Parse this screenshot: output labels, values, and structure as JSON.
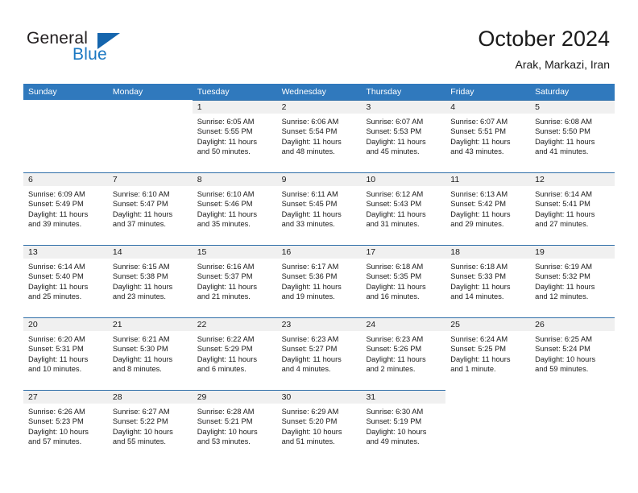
{
  "logo": {
    "word_one": "General",
    "word_two": "Blue",
    "triangle_color": "#1565ad"
  },
  "header": {
    "title": "October 2024",
    "subtitle": "Arak, Markazi, Iran"
  },
  "theme": {
    "header_blue": "#3079bd",
    "daynum_band": "#f0f0f0",
    "rule_blue": "#2e6ea8",
    "text": "#1a1a1a"
  },
  "calendar": {
    "weekdays": [
      "Sunday",
      "Monday",
      "Tuesday",
      "Wednesday",
      "Thursday",
      "Friday",
      "Saturday"
    ],
    "weeks": [
      [
        {
          "day": "",
          "sunrise": "",
          "sunset": "",
          "daylight1": "",
          "daylight2": "",
          "empty": true
        },
        {
          "day": "",
          "sunrise": "",
          "sunset": "",
          "daylight1": "",
          "daylight2": "",
          "empty": true
        },
        {
          "day": "1",
          "sunrise": "Sunrise: 6:05 AM",
          "sunset": "Sunset: 5:55 PM",
          "daylight1": "Daylight: 11 hours",
          "daylight2": "and 50 minutes."
        },
        {
          "day": "2",
          "sunrise": "Sunrise: 6:06 AM",
          "sunset": "Sunset: 5:54 PM",
          "daylight1": "Daylight: 11 hours",
          "daylight2": "and 48 minutes."
        },
        {
          "day": "3",
          "sunrise": "Sunrise: 6:07 AM",
          "sunset": "Sunset: 5:53 PM",
          "daylight1": "Daylight: 11 hours",
          "daylight2": "and 45 minutes."
        },
        {
          "day": "4",
          "sunrise": "Sunrise: 6:07 AM",
          "sunset": "Sunset: 5:51 PM",
          "daylight1": "Daylight: 11 hours",
          "daylight2": "and 43 minutes."
        },
        {
          "day": "5",
          "sunrise": "Sunrise: 6:08 AM",
          "sunset": "Sunset: 5:50 PM",
          "daylight1": "Daylight: 11 hours",
          "daylight2": "and 41 minutes."
        }
      ],
      [
        {
          "day": "6",
          "sunrise": "Sunrise: 6:09 AM",
          "sunset": "Sunset: 5:49 PM",
          "daylight1": "Daylight: 11 hours",
          "daylight2": "and 39 minutes."
        },
        {
          "day": "7",
          "sunrise": "Sunrise: 6:10 AM",
          "sunset": "Sunset: 5:47 PM",
          "daylight1": "Daylight: 11 hours",
          "daylight2": "and 37 minutes."
        },
        {
          "day": "8",
          "sunrise": "Sunrise: 6:10 AM",
          "sunset": "Sunset: 5:46 PM",
          "daylight1": "Daylight: 11 hours",
          "daylight2": "and 35 minutes."
        },
        {
          "day": "9",
          "sunrise": "Sunrise: 6:11 AM",
          "sunset": "Sunset: 5:45 PM",
          "daylight1": "Daylight: 11 hours",
          "daylight2": "and 33 minutes."
        },
        {
          "day": "10",
          "sunrise": "Sunrise: 6:12 AM",
          "sunset": "Sunset: 5:43 PM",
          "daylight1": "Daylight: 11 hours",
          "daylight2": "and 31 minutes."
        },
        {
          "day": "11",
          "sunrise": "Sunrise: 6:13 AM",
          "sunset": "Sunset: 5:42 PM",
          "daylight1": "Daylight: 11 hours",
          "daylight2": "and 29 minutes."
        },
        {
          "day": "12",
          "sunrise": "Sunrise: 6:14 AM",
          "sunset": "Sunset: 5:41 PM",
          "daylight1": "Daylight: 11 hours",
          "daylight2": "and 27 minutes."
        }
      ],
      [
        {
          "day": "13",
          "sunrise": "Sunrise: 6:14 AM",
          "sunset": "Sunset: 5:40 PM",
          "daylight1": "Daylight: 11 hours",
          "daylight2": "and 25 minutes."
        },
        {
          "day": "14",
          "sunrise": "Sunrise: 6:15 AM",
          "sunset": "Sunset: 5:38 PM",
          "daylight1": "Daylight: 11 hours",
          "daylight2": "and 23 minutes."
        },
        {
          "day": "15",
          "sunrise": "Sunrise: 6:16 AM",
          "sunset": "Sunset: 5:37 PM",
          "daylight1": "Daylight: 11 hours",
          "daylight2": "and 21 minutes."
        },
        {
          "day": "16",
          "sunrise": "Sunrise: 6:17 AM",
          "sunset": "Sunset: 5:36 PM",
          "daylight1": "Daylight: 11 hours",
          "daylight2": "and 19 minutes."
        },
        {
          "day": "17",
          "sunrise": "Sunrise: 6:18 AM",
          "sunset": "Sunset: 5:35 PM",
          "daylight1": "Daylight: 11 hours",
          "daylight2": "and 16 minutes."
        },
        {
          "day": "18",
          "sunrise": "Sunrise: 6:18 AM",
          "sunset": "Sunset: 5:33 PM",
          "daylight1": "Daylight: 11 hours",
          "daylight2": "and 14 minutes."
        },
        {
          "day": "19",
          "sunrise": "Sunrise: 6:19 AM",
          "sunset": "Sunset: 5:32 PM",
          "daylight1": "Daylight: 11 hours",
          "daylight2": "and 12 minutes."
        }
      ],
      [
        {
          "day": "20",
          "sunrise": "Sunrise: 6:20 AM",
          "sunset": "Sunset: 5:31 PM",
          "daylight1": "Daylight: 11 hours",
          "daylight2": "and 10 minutes."
        },
        {
          "day": "21",
          "sunrise": "Sunrise: 6:21 AM",
          "sunset": "Sunset: 5:30 PM",
          "daylight1": "Daylight: 11 hours",
          "daylight2": "and 8 minutes."
        },
        {
          "day": "22",
          "sunrise": "Sunrise: 6:22 AM",
          "sunset": "Sunset: 5:29 PM",
          "daylight1": "Daylight: 11 hours",
          "daylight2": "and 6 minutes."
        },
        {
          "day": "23",
          "sunrise": "Sunrise: 6:23 AM",
          "sunset": "Sunset: 5:27 PM",
          "daylight1": "Daylight: 11 hours",
          "daylight2": "and 4 minutes."
        },
        {
          "day": "24",
          "sunrise": "Sunrise: 6:23 AM",
          "sunset": "Sunset: 5:26 PM",
          "daylight1": "Daylight: 11 hours",
          "daylight2": "and 2 minutes."
        },
        {
          "day": "25",
          "sunrise": "Sunrise: 6:24 AM",
          "sunset": "Sunset: 5:25 PM",
          "daylight1": "Daylight: 11 hours",
          "daylight2": "and 1 minute."
        },
        {
          "day": "26",
          "sunrise": "Sunrise: 6:25 AM",
          "sunset": "Sunset: 5:24 PM",
          "daylight1": "Daylight: 10 hours",
          "daylight2": "and 59 minutes."
        }
      ],
      [
        {
          "day": "27",
          "sunrise": "Sunrise: 6:26 AM",
          "sunset": "Sunset: 5:23 PM",
          "daylight1": "Daylight: 10 hours",
          "daylight2": "and 57 minutes."
        },
        {
          "day": "28",
          "sunrise": "Sunrise: 6:27 AM",
          "sunset": "Sunset: 5:22 PM",
          "daylight1": "Daylight: 10 hours",
          "daylight2": "and 55 minutes."
        },
        {
          "day": "29",
          "sunrise": "Sunrise: 6:28 AM",
          "sunset": "Sunset: 5:21 PM",
          "daylight1": "Daylight: 10 hours",
          "daylight2": "and 53 minutes."
        },
        {
          "day": "30",
          "sunrise": "Sunrise: 6:29 AM",
          "sunset": "Sunset: 5:20 PM",
          "daylight1": "Daylight: 10 hours",
          "daylight2": "and 51 minutes."
        },
        {
          "day": "31",
          "sunrise": "Sunrise: 6:30 AM",
          "sunset": "Sunset: 5:19 PM",
          "daylight1": "Daylight: 10 hours",
          "daylight2": "and 49 minutes."
        },
        {
          "day": "",
          "sunrise": "",
          "sunset": "",
          "daylight1": "",
          "daylight2": "",
          "empty": true
        },
        {
          "day": "",
          "sunrise": "",
          "sunset": "",
          "daylight1": "",
          "daylight2": "",
          "empty": true
        }
      ]
    ]
  }
}
